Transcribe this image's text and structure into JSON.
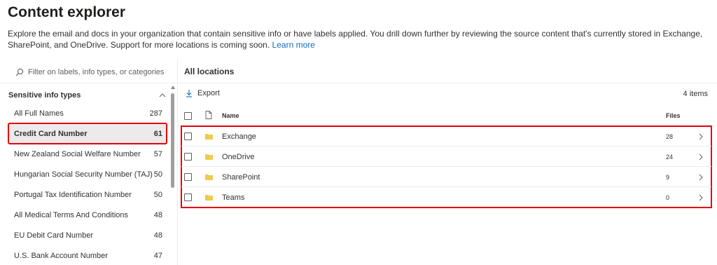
{
  "page": {
    "title": "Content explorer",
    "description": "Explore the email and docs in your organization that contain sensitive info or have labels applied. You drill down further by reviewing the source content that's currently stored in Exchange, SharePoint, and OneDrive. Support for more locations is coming soon.",
    "learn_more": "Learn more"
  },
  "filter": {
    "placeholder": "Filter on labels, info types, or categories",
    "icon": "search-icon"
  },
  "sidebar": {
    "section_title": "Sensitive info types",
    "items": [
      {
        "label": "All Full Names",
        "count": "287"
      },
      {
        "label": "Credit Card Number",
        "count": "61"
      },
      {
        "label": "New Zealand Social Welfare Number",
        "count": "57"
      },
      {
        "label": "Hungarian Social Security Number (TAJ)",
        "count": "50"
      },
      {
        "label": "Portugal Tax Identification Number",
        "count": "50"
      },
      {
        "label": "All Medical Terms And Conditions",
        "count": "48"
      },
      {
        "label": "EU Debit Card Number",
        "count": "48"
      },
      {
        "label": "U.S. Bank Account Number",
        "count": "47"
      }
    ],
    "selected_index": 1
  },
  "main": {
    "title": "All locations",
    "export_label": "Export",
    "item_count": "4 items",
    "columns": {
      "name": "Name",
      "files": "Files"
    },
    "rows": [
      {
        "name": "Exchange",
        "files": "28"
      },
      {
        "name": "OneDrive",
        "files": "24"
      },
      {
        "name": "SharePoint",
        "files": "9"
      },
      {
        "name": "Teams",
        "files": "0"
      }
    ]
  },
  "colors": {
    "accent": "#0f6cbd",
    "highlight_border": "#e3000f",
    "folder": "#f2c94c",
    "selected_bg": "#edebe9"
  }
}
